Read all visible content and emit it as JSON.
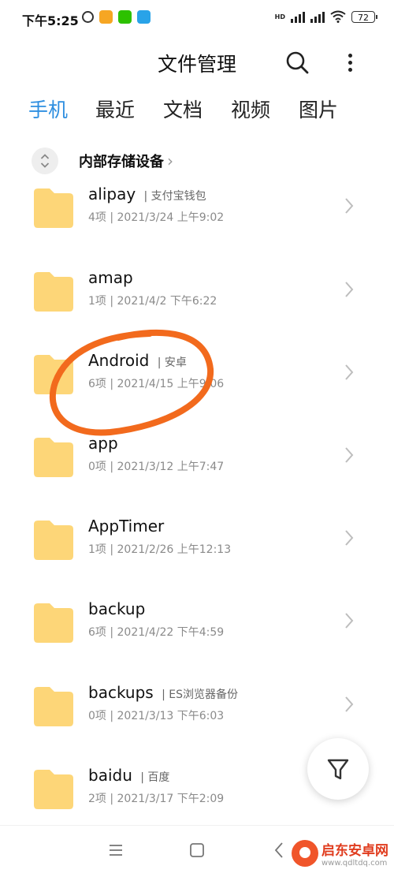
{
  "status_bar": {
    "time": "下午5:25",
    "battery": "72",
    "network": "HD"
  },
  "header": {
    "title": "文件管理"
  },
  "tabs": [
    {
      "label": "手机",
      "active": true
    },
    {
      "label": "最近",
      "active": false
    },
    {
      "label": "文档",
      "active": false
    },
    {
      "label": "视频",
      "active": false
    },
    {
      "label": "图片",
      "active": false
    }
  ],
  "breadcrumb": {
    "label": "内部存储设备"
  },
  "folders": [
    {
      "name": "alipay",
      "tag": "| 支付宝钱包",
      "meta": "4项 | 2021/3/24 上午9:02"
    },
    {
      "name": "amap",
      "tag": "",
      "meta": "1项 | 2021/4/2 下午6:22"
    },
    {
      "name": "Android",
      "tag": "| 安卓",
      "meta": "6项 | 2021/4/15 上午9:06"
    },
    {
      "name": "app",
      "tag": "",
      "meta": "0项 | 2021/3/12 上午7:47"
    },
    {
      "name": "AppTimer",
      "tag": "",
      "meta": "1项 | 2021/2/26 上午12:13"
    },
    {
      "name": "backup",
      "tag": "",
      "meta": "6项 | 2021/4/22 下午4:59"
    },
    {
      "name": "backups",
      "tag": "| ES浏览器备份",
      "meta": "0项 | 2021/3/13 下午6:03"
    },
    {
      "name": "baidu",
      "tag": "| 百度",
      "meta": "2项 | 2021/3/17 下午2:09"
    }
  ],
  "watermark": {
    "name": "启东安卓网",
    "url": "www.qdltdq.com"
  },
  "colors": {
    "accent": "#2f8fe0",
    "folder": "#fdd678",
    "annotation": "#f26a1d"
  },
  "icons": {
    "search": "search-icon",
    "more": "more-vert-icon",
    "filter": "filter-icon",
    "folder": "folder-icon"
  }
}
